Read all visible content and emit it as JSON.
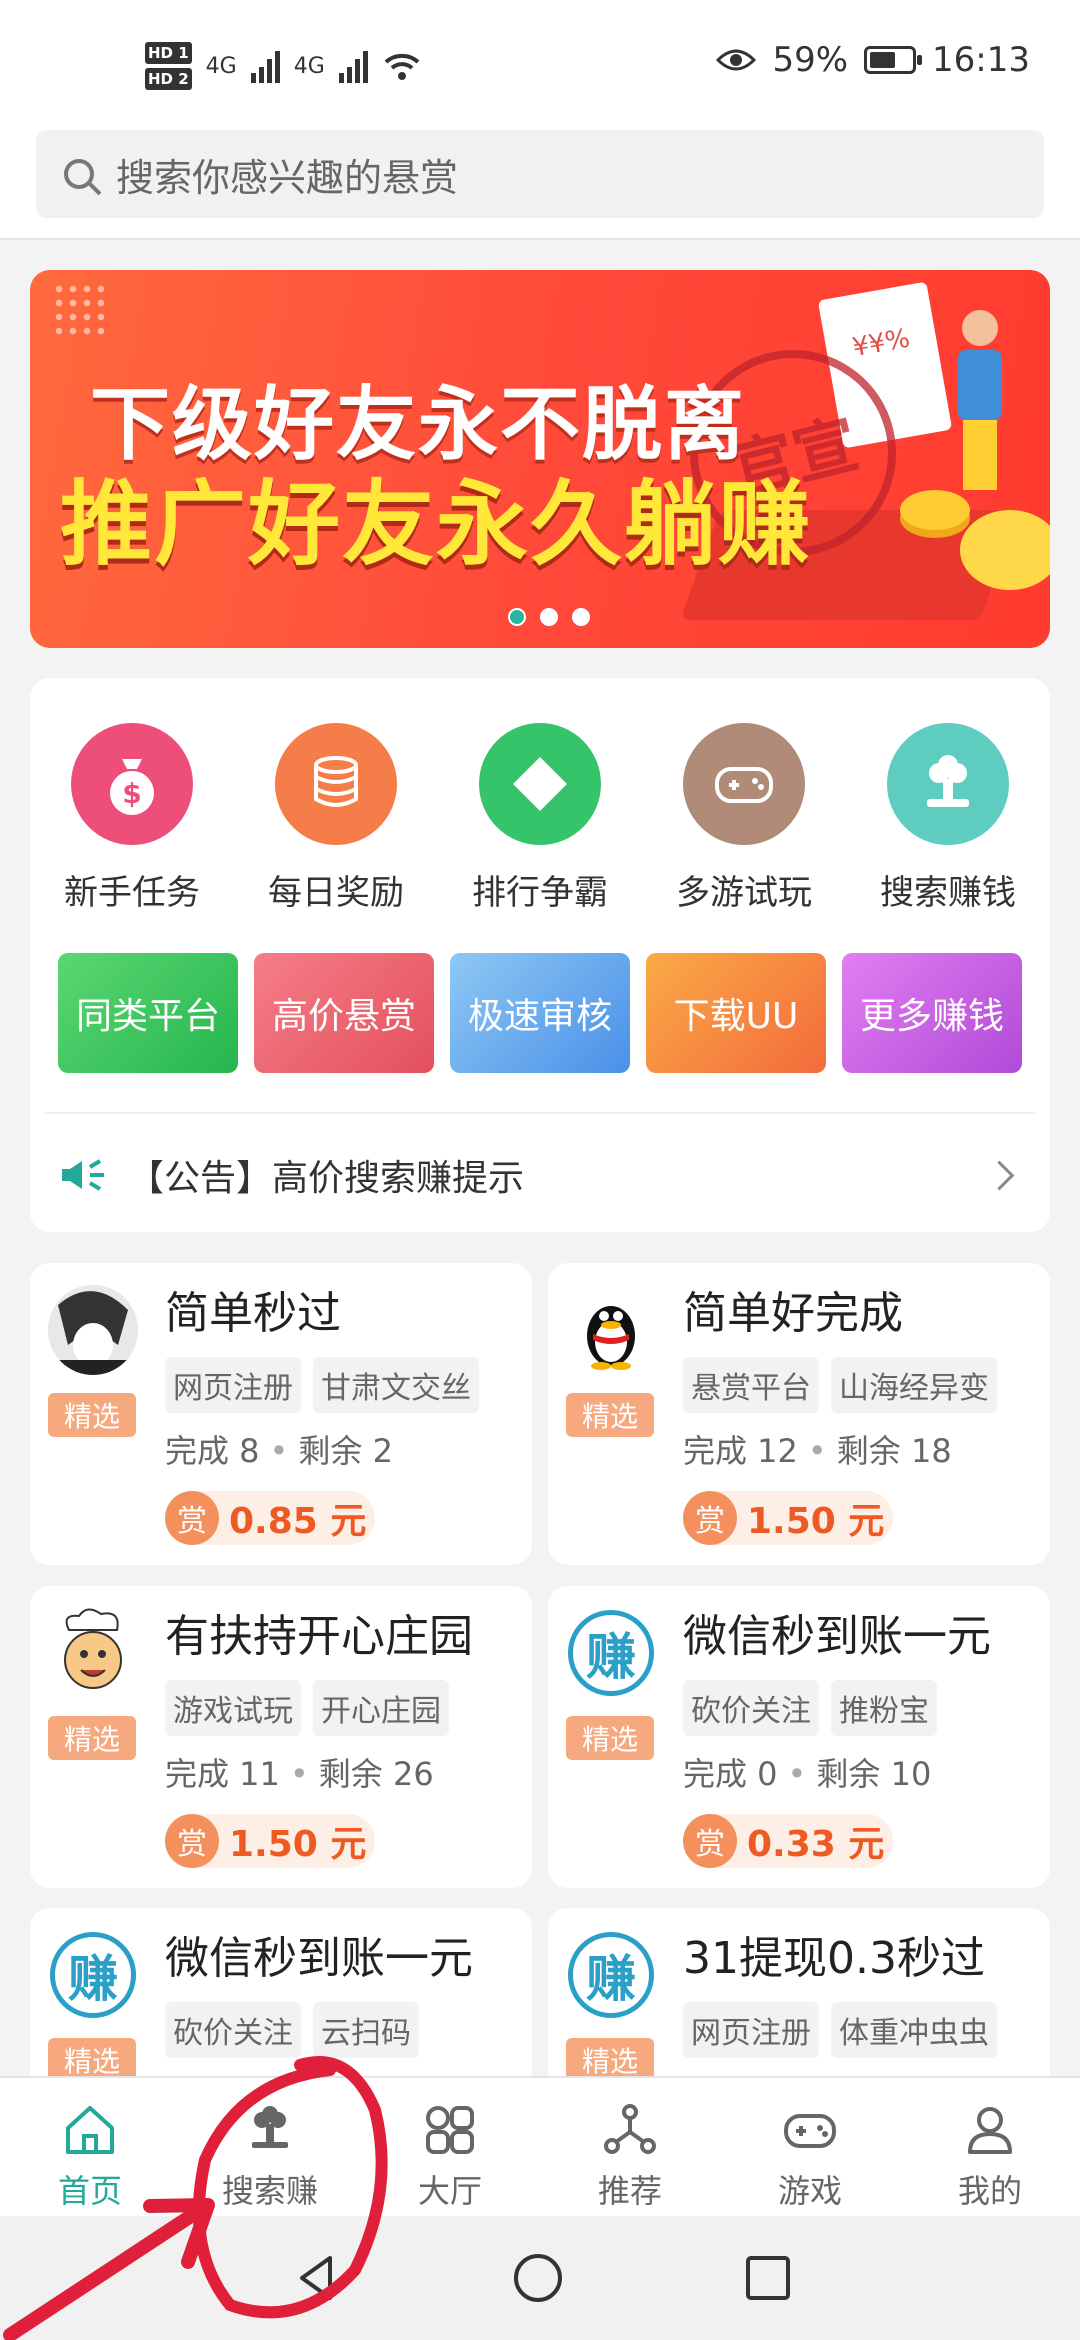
{
  "status_bar": {
    "time": "16:13",
    "battery": "59%",
    "hd1": "HD 1",
    "hd2": "HD 2",
    "net1": "4G",
    "net2": "4G"
  },
  "search": {
    "placeholder": "搜索你感兴趣的悬赏"
  },
  "banner": {
    "line1": "下级好友永不脱离",
    "line2": "推广好友永久躺赚",
    "stamp": "官宣",
    "doc_text": "¥¥%",
    "active_dot": 0
  },
  "menu_icons": [
    {
      "label": "新手任务",
      "icon": "money-bag-icon",
      "color": "#ee4f7a"
    },
    {
      "label": "每日奖励",
      "icon": "coins-icon",
      "color": "#f47d4a"
    },
    {
      "label": "排行争霸",
      "icon": "diamond-icon",
      "color": "#35c46a"
    },
    {
      "label": "多游试玩",
      "icon": "gamepad-icon",
      "color": "#b08b78"
    },
    {
      "label": "搜索赚钱",
      "icon": "search-earn-icon",
      "color": "#5ecdc0"
    }
  ],
  "grad_buttons": [
    {
      "label": "同类平台",
      "color1": "#5bd672",
      "color2": "#25b64e"
    },
    {
      "label": "高价悬赏",
      "color1": "#f57e88",
      "color2": "#e4505d"
    },
    {
      "label": "极速审核",
      "color1": "#8ec8f4",
      "color2": "#4a90e8"
    },
    {
      "label": "下载UU",
      "color1": "#fbaa46",
      "color2": "#f36b3b"
    },
    {
      "label": "更多赚钱",
      "color1": "#e27ef0",
      "color2": "#b04bd8"
    }
  ],
  "notice": {
    "text": "【公告】高价搜索赚提示"
  },
  "tasks": [
    {
      "title": "简单秒过",
      "tags": [
        "网页注册",
        "甘肃文交丝"
      ],
      "badge": "精选",
      "done": "完成 8",
      "remain": "剩余 2",
      "reward_label": "赏",
      "reward": "0.85 元",
      "avatar": "anime-avatar"
    },
    {
      "title": "简单好完成",
      "tags": [
        "悬赏平台",
        "山海经异变"
      ],
      "badge": "精选",
      "done": "完成 12",
      "remain": "剩余 18",
      "reward_label": "赏",
      "reward": "1.50 元",
      "avatar": "penguin-avatar"
    },
    {
      "title": "有扶持开心庄园",
      "tags": [
        "游戏试玩",
        "开心庄园"
      ],
      "badge": "精选",
      "done": "完成 11",
      "remain": "剩余 26",
      "reward_label": "赏",
      "reward": "1.50 元",
      "avatar": "chef-avatar"
    },
    {
      "title": "微信秒到账一元",
      "tags": [
        "砍价关注",
        "推粉宝"
      ],
      "badge": "精选",
      "done": "完成 0",
      "remain": "剩余 10",
      "reward_label": "赏",
      "reward": "0.33 元",
      "avatar": "zuan-avatar"
    },
    {
      "title": "微信秒到账一元",
      "tags": [
        "砍价关注",
        "云扫码"
      ],
      "badge": "精选",
      "avatar": "zuan-avatar"
    },
    {
      "title": "31提现0.3秒过",
      "tags": [
        "网页注册",
        "体重冲虫虫"
      ],
      "badge": "精选",
      "avatar": "zuan-avatar"
    }
  ],
  "avatar_glyph": "赚",
  "bottom_nav": [
    {
      "label": "首页",
      "icon": "home-icon",
      "active": true
    },
    {
      "label": "搜索赚",
      "icon": "search-earn-icon",
      "active": false
    },
    {
      "label": "大厅",
      "icon": "grid-icon",
      "active": false
    },
    {
      "label": "推荐",
      "icon": "share-icon",
      "active": false
    },
    {
      "label": "游戏",
      "icon": "gamepad-icon",
      "active": false
    },
    {
      "label": "我的",
      "icon": "user-icon",
      "active": false
    }
  ],
  "colors": {
    "accent": "#23a89a",
    "reward": "#ee5a24",
    "annotation": "#e0203a"
  }
}
